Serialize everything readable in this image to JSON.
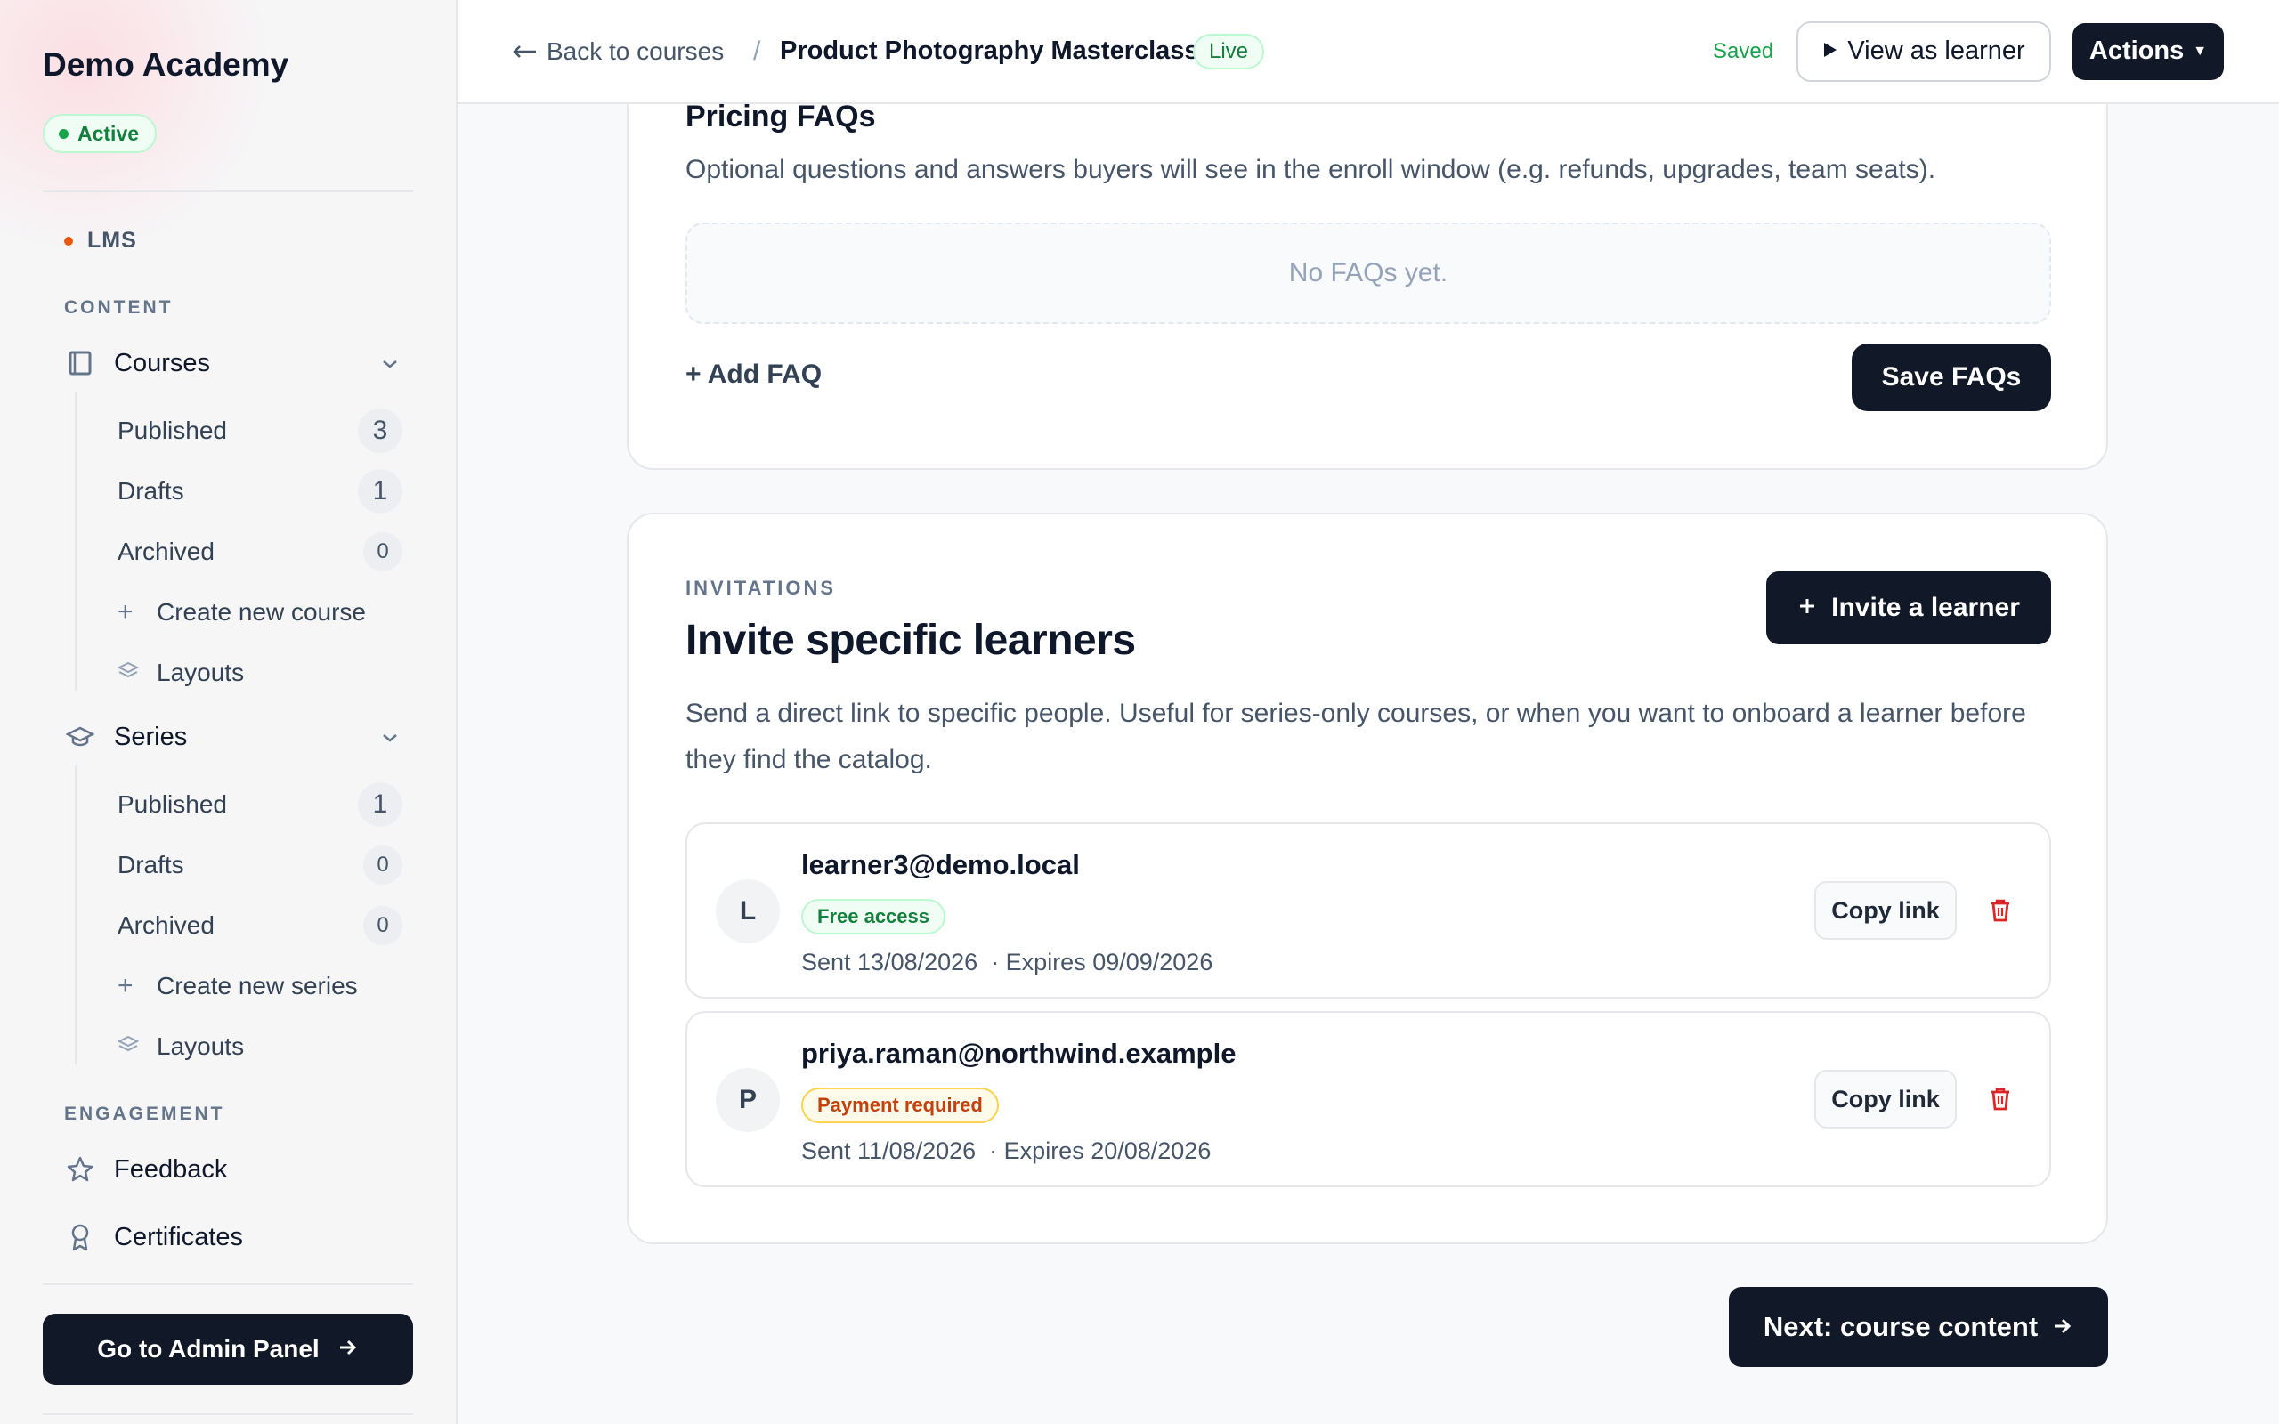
{
  "sidebar": {
    "brand": "Demo Academy",
    "status": "Active",
    "app_label": "LMS",
    "sections": {
      "content": "CONTENT",
      "engagement": "ENGAGEMENT"
    },
    "courses": {
      "label": "Courses",
      "icon": "book-icon",
      "items": [
        {
          "label": "Published",
          "count": "3"
        },
        {
          "label": "Drafts",
          "count": "1"
        },
        {
          "label": "Archived",
          "count": "0"
        }
      ],
      "create": "Create new course",
      "layouts": "Layouts"
    },
    "series": {
      "label": "Series",
      "icon": "graduation-cap-icon",
      "items": [
        {
          "label": "Published",
          "count": "1"
        },
        {
          "label": "Drafts",
          "count": "0"
        },
        {
          "label": "Archived",
          "count": "0"
        }
      ],
      "create": "Create new series",
      "layouts": "Layouts"
    },
    "engagement": [
      {
        "label": "Feedback",
        "icon": "star-icon"
      },
      {
        "label": "Certificates",
        "icon": "award-icon"
      }
    ],
    "admin_button": "Go to Admin Panel"
  },
  "header": {
    "back": "Back to courses",
    "separator": "/",
    "course_title": "Product Photography Masterclass",
    "status": "Live",
    "saved": "Saved",
    "view_as_learner": "View as learner",
    "actions": "Actions"
  },
  "faq": {
    "title": "Pricing FAQs",
    "description": "Optional questions and answers buyers will see in the enroll window (e.g. refunds, upgrades, team seats).",
    "empty": "No FAQs yet.",
    "add": "+ Add FAQ",
    "save": "Save FAQs"
  },
  "invitations": {
    "eyebrow": "INVITATIONS",
    "title": "Invite specific learners",
    "invite_button": "Invite a learner",
    "description": "Send a direct link to specific people. Useful for series-only courses, or when you want to onboard a learner before they find the catalog.",
    "copy_label": "Copy link",
    "rows": [
      {
        "initial": "L",
        "email": "learner3@demo.local",
        "access": "Free access",
        "meta": "Sent 13/08/2026  · Expires 09/09/2026"
      },
      {
        "initial": "P",
        "email": "priya.raman@northwind.example",
        "access": "Payment required",
        "meta": "Sent 11/08/2026  · Expires 20/08/2026"
      }
    ]
  },
  "footer": {
    "next": "Next: course content"
  },
  "colors": {
    "primary": "#111827",
    "success": "#15803d",
    "warning": "#c2410c",
    "danger": "#dc2626"
  }
}
